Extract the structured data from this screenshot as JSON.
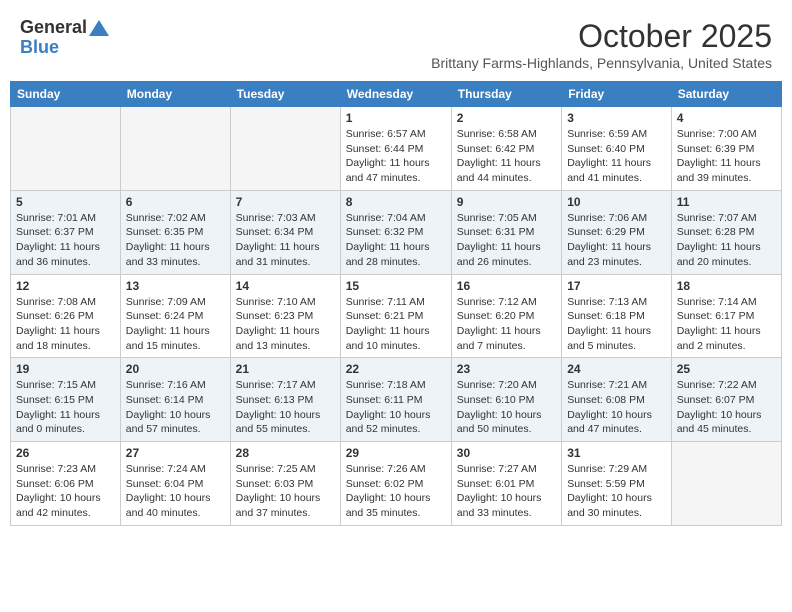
{
  "logo": {
    "general": "General",
    "blue": "Blue"
  },
  "title": "October 2025",
  "subtitle": "Brittany Farms-Highlands, Pennsylvania, United States",
  "weekdays": [
    "Sunday",
    "Monday",
    "Tuesday",
    "Wednesday",
    "Thursday",
    "Friday",
    "Saturday"
  ],
  "weeks": [
    [
      {
        "day": "",
        "info": ""
      },
      {
        "day": "",
        "info": ""
      },
      {
        "day": "",
        "info": ""
      },
      {
        "day": "1",
        "info": "Sunrise: 6:57 AM\nSunset: 6:44 PM\nDaylight: 11 hours\nand 47 minutes."
      },
      {
        "day": "2",
        "info": "Sunrise: 6:58 AM\nSunset: 6:42 PM\nDaylight: 11 hours\nand 44 minutes."
      },
      {
        "day": "3",
        "info": "Sunrise: 6:59 AM\nSunset: 6:40 PM\nDaylight: 11 hours\nand 41 minutes."
      },
      {
        "day": "4",
        "info": "Sunrise: 7:00 AM\nSunset: 6:39 PM\nDaylight: 11 hours\nand 39 minutes."
      }
    ],
    [
      {
        "day": "5",
        "info": "Sunrise: 7:01 AM\nSunset: 6:37 PM\nDaylight: 11 hours\nand 36 minutes."
      },
      {
        "day": "6",
        "info": "Sunrise: 7:02 AM\nSunset: 6:35 PM\nDaylight: 11 hours\nand 33 minutes."
      },
      {
        "day": "7",
        "info": "Sunrise: 7:03 AM\nSunset: 6:34 PM\nDaylight: 11 hours\nand 31 minutes."
      },
      {
        "day": "8",
        "info": "Sunrise: 7:04 AM\nSunset: 6:32 PM\nDaylight: 11 hours\nand 28 minutes."
      },
      {
        "day": "9",
        "info": "Sunrise: 7:05 AM\nSunset: 6:31 PM\nDaylight: 11 hours\nand 26 minutes."
      },
      {
        "day": "10",
        "info": "Sunrise: 7:06 AM\nSunset: 6:29 PM\nDaylight: 11 hours\nand 23 minutes."
      },
      {
        "day": "11",
        "info": "Sunrise: 7:07 AM\nSunset: 6:28 PM\nDaylight: 11 hours\nand 20 minutes."
      }
    ],
    [
      {
        "day": "12",
        "info": "Sunrise: 7:08 AM\nSunset: 6:26 PM\nDaylight: 11 hours\nand 18 minutes."
      },
      {
        "day": "13",
        "info": "Sunrise: 7:09 AM\nSunset: 6:24 PM\nDaylight: 11 hours\nand 15 minutes."
      },
      {
        "day": "14",
        "info": "Sunrise: 7:10 AM\nSunset: 6:23 PM\nDaylight: 11 hours\nand 13 minutes."
      },
      {
        "day": "15",
        "info": "Sunrise: 7:11 AM\nSunset: 6:21 PM\nDaylight: 11 hours\nand 10 minutes."
      },
      {
        "day": "16",
        "info": "Sunrise: 7:12 AM\nSunset: 6:20 PM\nDaylight: 11 hours\nand 7 minutes."
      },
      {
        "day": "17",
        "info": "Sunrise: 7:13 AM\nSunset: 6:18 PM\nDaylight: 11 hours\nand 5 minutes."
      },
      {
        "day": "18",
        "info": "Sunrise: 7:14 AM\nSunset: 6:17 PM\nDaylight: 11 hours\nand 2 minutes."
      }
    ],
    [
      {
        "day": "19",
        "info": "Sunrise: 7:15 AM\nSunset: 6:15 PM\nDaylight: 11 hours\nand 0 minutes."
      },
      {
        "day": "20",
        "info": "Sunrise: 7:16 AM\nSunset: 6:14 PM\nDaylight: 10 hours\nand 57 minutes."
      },
      {
        "day": "21",
        "info": "Sunrise: 7:17 AM\nSunset: 6:13 PM\nDaylight: 10 hours\nand 55 minutes."
      },
      {
        "day": "22",
        "info": "Sunrise: 7:18 AM\nSunset: 6:11 PM\nDaylight: 10 hours\nand 52 minutes."
      },
      {
        "day": "23",
        "info": "Sunrise: 7:20 AM\nSunset: 6:10 PM\nDaylight: 10 hours\nand 50 minutes."
      },
      {
        "day": "24",
        "info": "Sunrise: 7:21 AM\nSunset: 6:08 PM\nDaylight: 10 hours\nand 47 minutes."
      },
      {
        "day": "25",
        "info": "Sunrise: 7:22 AM\nSunset: 6:07 PM\nDaylight: 10 hours\nand 45 minutes."
      }
    ],
    [
      {
        "day": "26",
        "info": "Sunrise: 7:23 AM\nSunset: 6:06 PM\nDaylight: 10 hours\nand 42 minutes."
      },
      {
        "day": "27",
        "info": "Sunrise: 7:24 AM\nSunset: 6:04 PM\nDaylight: 10 hours\nand 40 minutes."
      },
      {
        "day": "28",
        "info": "Sunrise: 7:25 AM\nSunset: 6:03 PM\nDaylight: 10 hours\nand 37 minutes."
      },
      {
        "day": "29",
        "info": "Sunrise: 7:26 AM\nSunset: 6:02 PM\nDaylight: 10 hours\nand 35 minutes."
      },
      {
        "day": "30",
        "info": "Sunrise: 7:27 AM\nSunset: 6:01 PM\nDaylight: 10 hours\nand 33 minutes."
      },
      {
        "day": "31",
        "info": "Sunrise: 7:29 AM\nSunset: 5:59 PM\nDaylight: 10 hours\nand 30 minutes."
      },
      {
        "day": "",
        "info": ""
      }
    ]
  ]
}
